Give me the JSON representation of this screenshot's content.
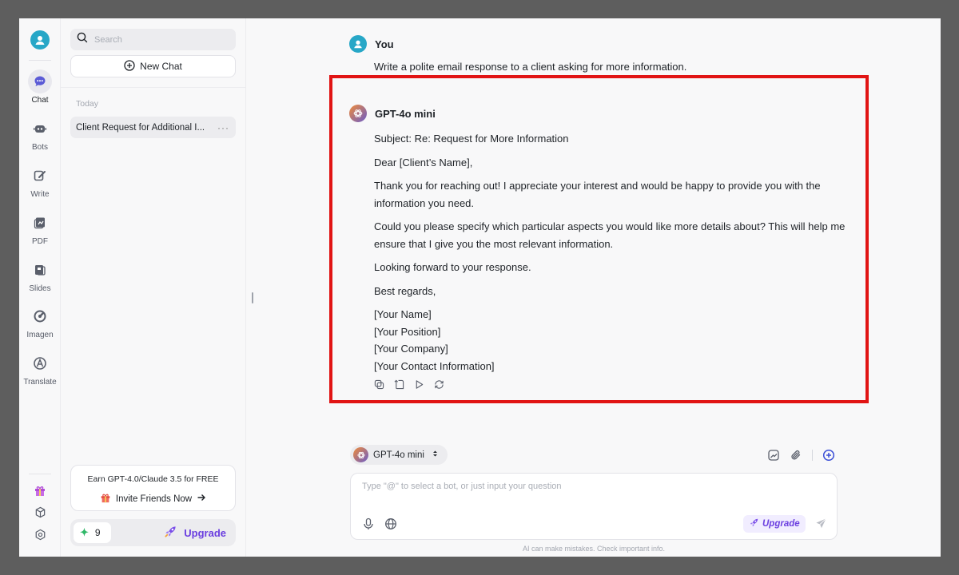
{
  "rail": {
    "items": [
      {
        "label": "Chat",
        "icon": "chat-icon"
      },
      {
        "label": "Bots",
        "icon": "bot-icon"
      },
      {
        "label": "Write",
        "icon": "write-icon"
      },
      {
        "label": "PDF",
        "icon": "pdf-icon"
      },
      {
        "label": "Slides",
        "icon": "slides-icon"
      },
      {
        "label": "Imagen",
        "icon": "image-icon"
      },
      {
        "label": "Translate",
        "icon": "translate-icon"
      }
    ],
    "bottom_icons": [
      "gift-icon",
      "cube-icon",
      "settings-icon"
    ]
  },
  "sidebar": {
    "search_placeholder": "Search",
    "new_chat_label": "New Chat",
    "section_label": "Today",
    "chats": [
      {
        "title": "Client Request for Additional I..."
      }
    ],
    "more_label": "···",
    "promo_text": "Earn GPT-4.0/Claude 3.5 for FREE",
    "invite_label": "Invite Friends Now",
    "credits": "9",
    "upgrade_label": "Upgrade"
  },
  "conversation": {
    "user_name": "You",
    "user_message": "Write a polite email response to a client asking for more information.",
    "bot_name": "GPT-4o mini",
    "reply": {
      "subject": "Subject: Re: Request for More Information",
      "greeting": "Dear [Client’s Name],",
      "para1": "Thank you for reaching out! I appreciate your interest and would be happy to provide you with the information you need.",
      "para2": "Could you please specify which particular aspects you would like more details about? This will help me ensure that I give you the most relevant information.",
      "para3": "Looking forward to your response.",
      "closing": "Best regards,",
      "signature": [
        "[Your Name]",
        "[Your Position]",
        "[Your Company]",
        "[Your Contact Information]"
      ]
    }
  },
  "composer": {
    "model_label": "GPT-4o mini",
    "placeholder": "Type \"@\" to select a bot, or just input your question",
    "upgrade_label": "Upgrade",
    "disclaimer": "AI can make mistakes. Check important info."
  },
  "colors": {
    "accent": "#6b3fe0",
    "avatar": "#27a7c7",
    "highlight": "#e11414"
  }
}
